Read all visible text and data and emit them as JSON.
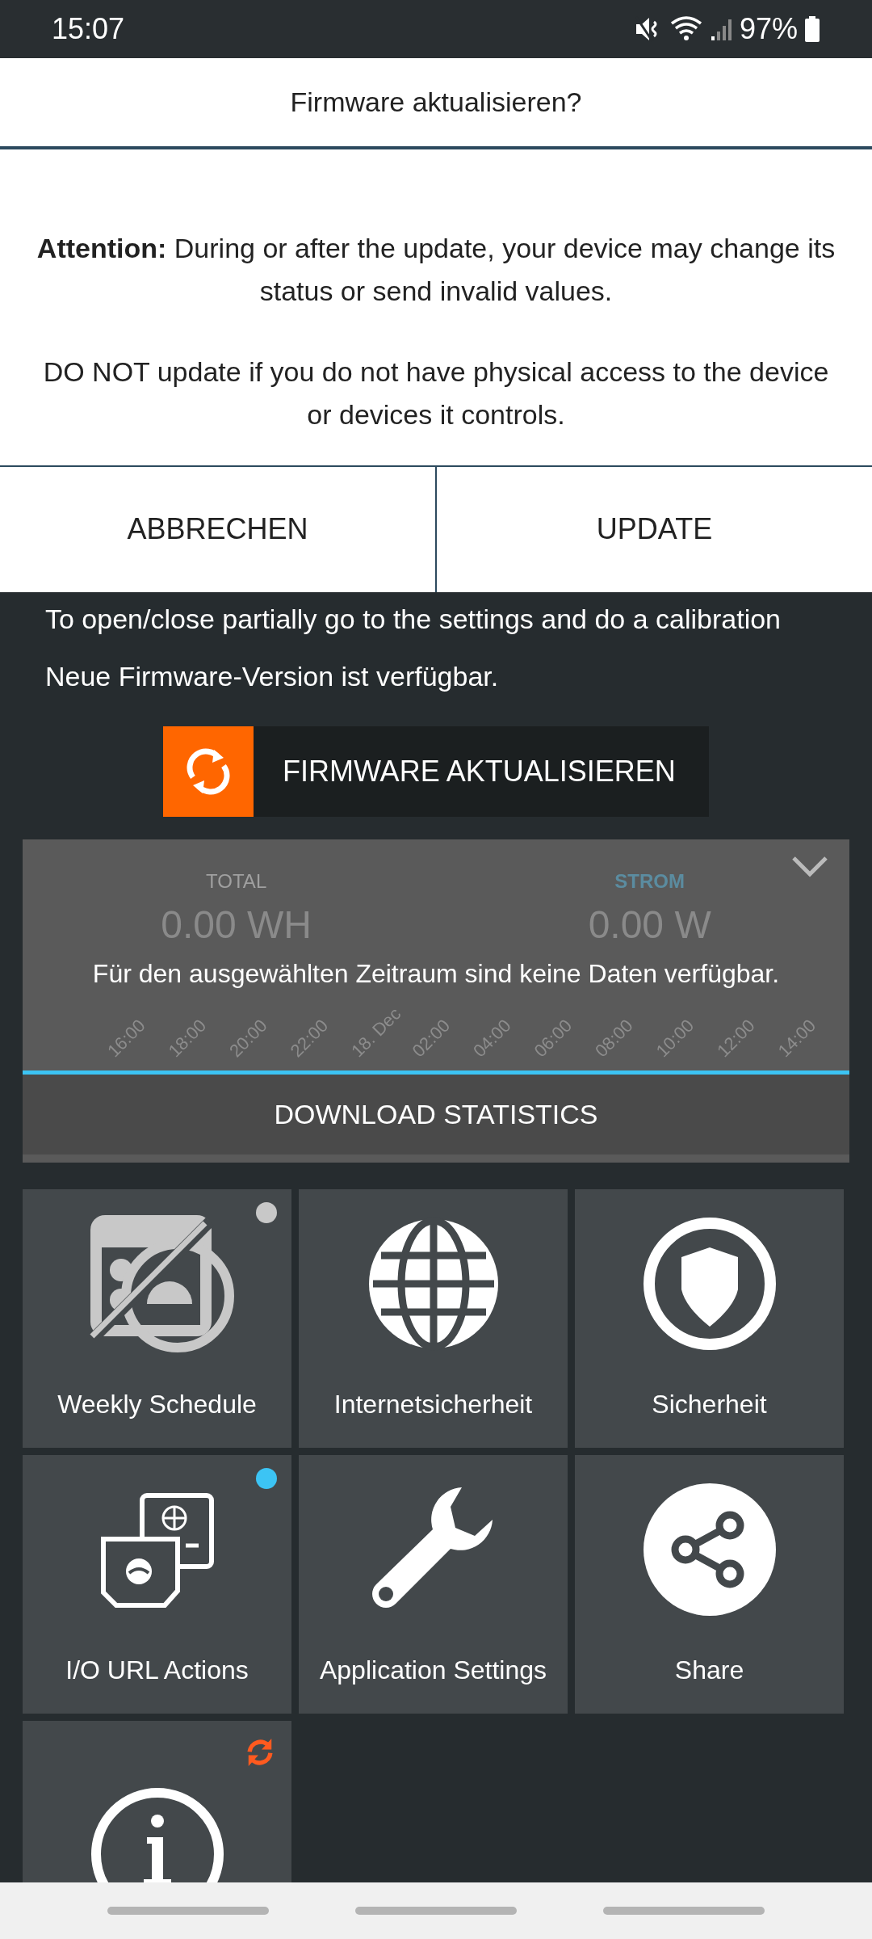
{
  "status_bar": {
    "time": "15:07",
    "battery": "97%"
  },
  "dialog": {
    "title": "Firmware aktualisieren?",
    "paragraphs": [
      "**Attention:** During or after the update, your device may change its status or send invalid values.",
      "DO NOT update if you do not have physical access to the device or devices it controls."
    ],
    "buttons": [
      "ABBRECHEN",
      "UPDATE"
    ]
  },
  "notes": [
    "To open/close partially go to the settings and do a calibration",
    "Neue Firmware-Version ist verfügbar."
  ],
  "firmware_button": {
    "label": "FIRMWARE AKTUALISIEREN"
  },
  "statistics": {
    "metrics": [
      {
        "label": "TOTAL",
        "value": "0.00 WH",
        "selected": false
      },
      {
        "label": "STROM",
        "value": "0.00 W",
        "selected": true
      }
    ],
    "x_labels": [
      "16:00",
      "18:00",
      "20:00",
      "22:00",
      "18. Dec",
      "02:00",
      "04:00",
      "06:00",
      "08:00",
      "10:00",
      "12:00",
      "14:00"
    ],
    "message": "Für den ausgewählten Zeitraum sind keine Daten verfügbar.",
    "download_button": "DOWNLOAD STATISTICS"
  },
  "tiles": [
    {
      "label": "Weekly Schedule",
      "kind": "schedule",
      "color": "#c8c8c8"
    },
    {
      "label": "Internetsicherheit",
      "kind": "globe"
    },
    {
      "label": "Sicherheit",
      "kind": "shield"
    },
    {
      "label": "I/O URL Actions",
      "kind": "devices",
      "color": "#3cc4f4"
    },
    {
      "label": "Application Settings",
      "kind": "wrench"
    },
    {
      "label": "Share",
      "kind": "share"
    },
    {
      "kind": "info",
      "update_available": true
    }
  ]
}
